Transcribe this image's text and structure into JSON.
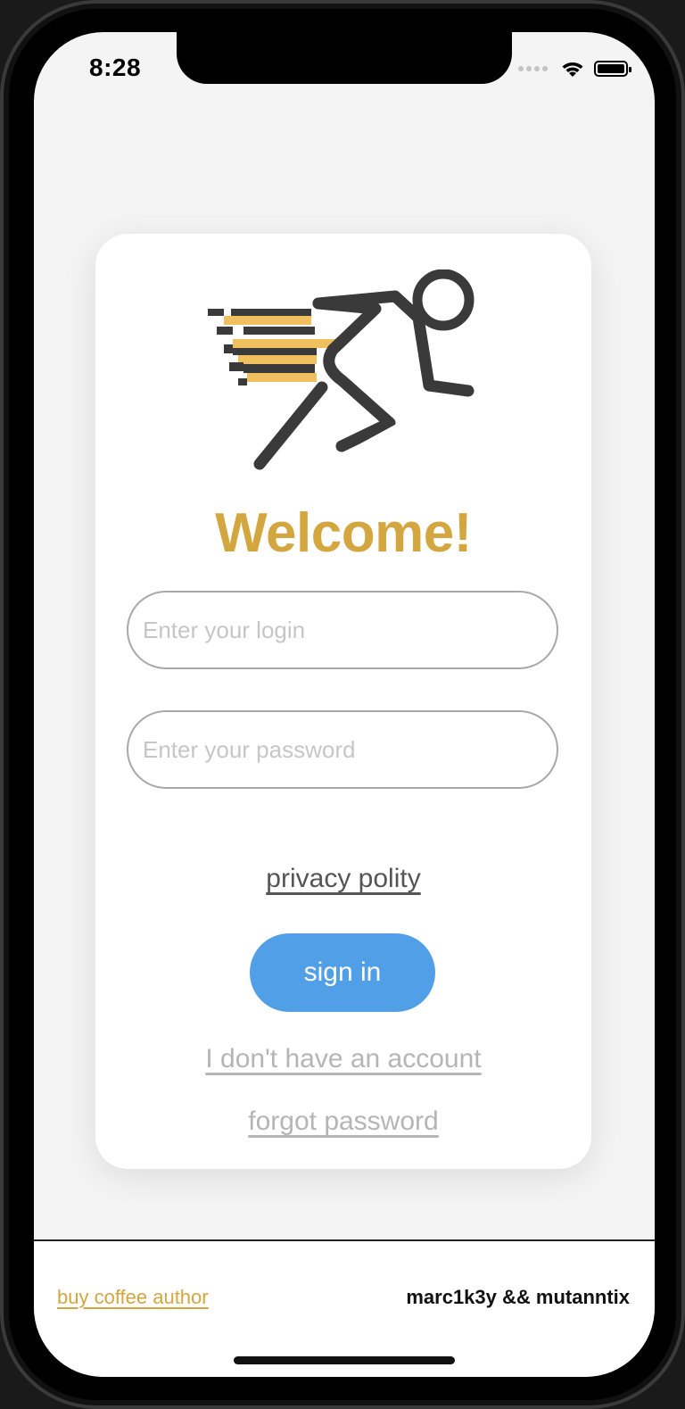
{
  "status_bar": {
    "time": "8:28",
    "icons": [
      "signal-dots-icon",
      "wifi-icon",
      "battery-icon"
    ]
  },
  "login_card": {
    "logo_icon": "running-person-icon",
    "title": "Welcome!",
    "login_placeholder": "Enter your login",
    "password_placeholder": "Enter your password",
    "privacy_link": "privacy polity",
    "sign_in_label": "sign in",
    "no_account_link": "I don't have an account",
    "forgot_password_link": "forgot password"
  },
  "footer": {
    "coffee_link": "buy coffee author",
    "authors": "marc1k3y && mutanntix"
  },
  "colors": {
    "accent_gold": "#d4a640",
    "button_blue": "#519fe7",
    "background": "#f4f4f4",
    "card": "#ffffff"
  }
}
